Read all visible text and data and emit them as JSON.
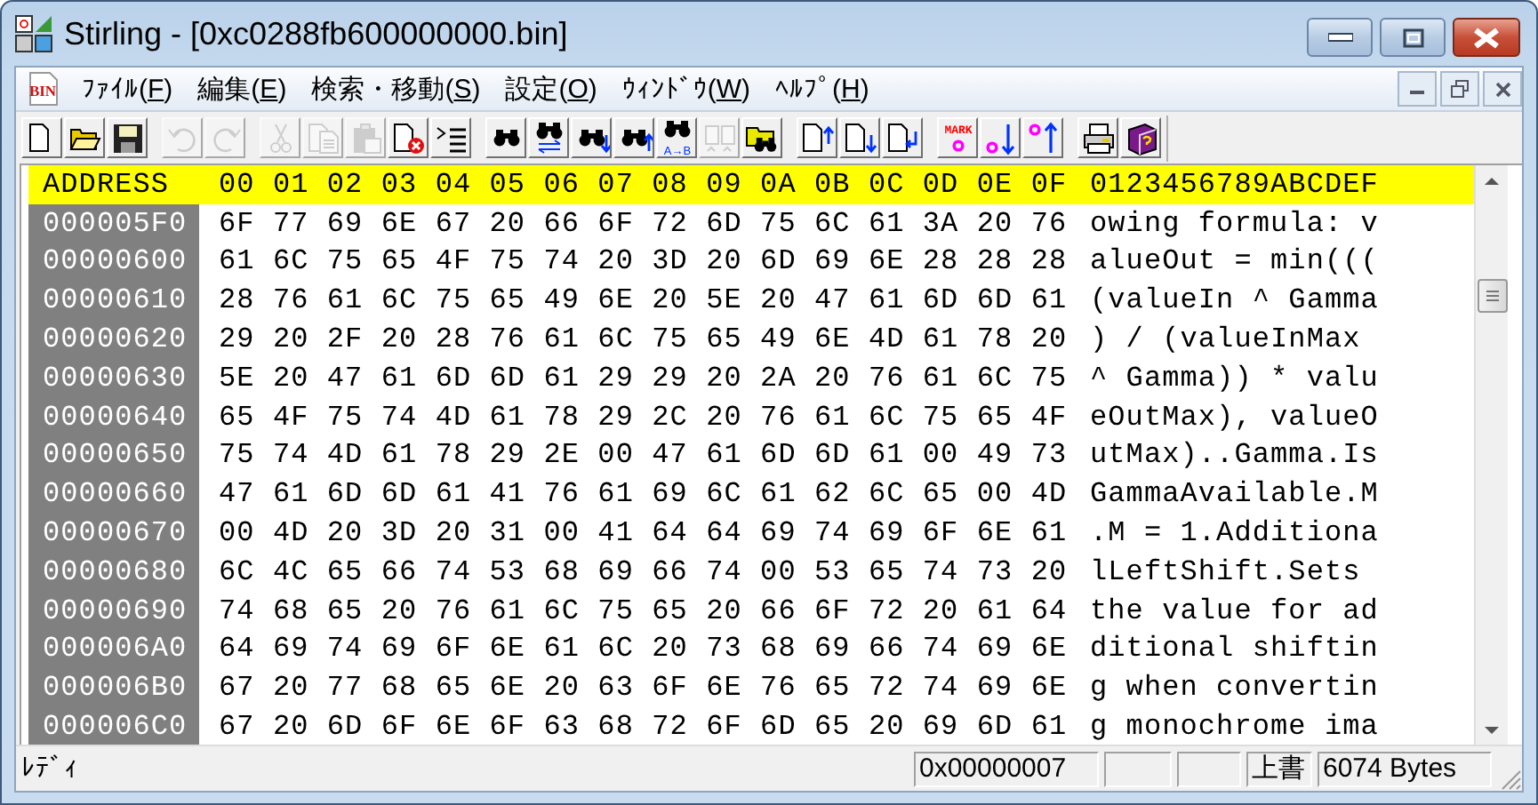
{
  "window": {
    "title": "Stirling - [0xc0288fb600000000.bin]"
  },
  "menu_bar": {
    "icon_label": "BIN",
    "items": [
      {
        "before": "ﾌｧｲﾙ(",
        "key": "F",
        "after": ")"
      },
      {
        "before": "編集(",
        "key": "E",
        "after": ")"
      },
      {
        "before": "検索・移動(",
        "key": "S",
        "after": ")"
      },
      {
        "before": "設定(",
        "key": "O",
        "after": ")"
      },
      {
        "before": "ｳｨﾝﾄﾞｳ(",
        "key": "W",
        "after": ")"
      },
      {
        "before": "ﾍﾙﾌﾟ(",
        "key": "H",
        "after": ")"
      }
    ]
  },
  "toolbar": [
    [
      {
        "kind": "new",
        "disabled": false
      },
      {
        "kind": "open",
        "disabled": false
      },
      {
        "kind": "save",
        "disabled": false
      }
    ],
    [
      {
        "kind": "undo",
        "disabled": true
      },
      {
        "kind": "redo",
        "disabled": true
      }
    ],
    [
      {
        "kind": "cut",
        "disabled": true
      },
      {
        "kind": "copy",
        "disabled": true
      },
      {
        "kind": "paste",
        "disabled": true
      },
      {
        "kind": "close",
        "disabled": false
      },
      {
        "kind": "list",
        "disabled": false
      }
    ],
    [
      {
        "kind": "find",
        "disabled": false
      },
      {
        "kind": "replace",
        "disabled": false
      },
      {
        "kind": "find-next",
        "disabled": false
      },
      {
        "kind": "find-prev",
        "disabled": false
      },
      {
        "kind": "compare",
        "disabled": false,
        "label": "A→B"
      },
      {
        "kind": "compare-pages",
        "disabled": true
      },
      {
        "kind": "find-folder",
        "disabled": false
      }
    ],
    [
      {
        "kind": "doc-up",
        "disabled": false
      },
      {
        "kind": "doc-down",
        "disabled": false
      },
      {
        "kind": "doc-return",
        "disabled": false
      }
    ],
    [
      {
        "kind": "mark",
        "disabled": false,
        "label": "MARK"
      },
      {
        "kind": "mark-next",
        "disabled": false
      },
      {
        "kind": "mark-prev",
        "disabled": false
      }
    ],
    [
      {
        "kind": "print",
        "disabled": false
      },
      {
        "kind": "help",
        "disabled": false
      }
    ]
  ],
  "hex_view": {
    "header": {
      "address": "ADDRESS",
      "offsets": "00 01 02 03 04 05 06 07 08 09 0A 0B 0C 0D 0E 0F",
      "ascii": "0123456789ABCDEF"
    },
    "rows": [
      {
        "address": "000005F0",
        "hex": "6F 77 69 6E 67 20 66 6F 72 6D 75 6C 61 3A 20 76",
        "ascii": "owing formula: v"
      },
      {
        "address": "00000600",
        "hex": "61 6C 75 65 4F 75 74 20 3D 20 6D 69 6E 28 28 28",
        "ascii": "alueOut = min((("
      },
      {
        "address": "00000610",
        "hex": "28 76 61 6C 75 65 49 6E 20 5E 20 47 61 6D 6D 61",
        "ascii": "(valueIn ^ Gamma"
      },
      {
        "address": "00000620",
        "hex": "29 20 2F 20 28 76 61 6C 75 65 49 6E 4D 61 78 20",
        "ascii": ") / (valueInMax "
      },
      {
        "address": "00000630",
        "hex": "5E 20 47 61 6D 6D 61 29 29 20 2A 20 76 61 6C 75",
        "ascii": "^ Gamma)) * valu"
      },
      {
        "address": "00000640",
        "hex": "65 4F 75 74 4D 61 78 29 2C 20 76 61 6C 75 65 4F",
        "ascii": "eOutMax), valueO"
      },
      {
        "address": "00000650",
        "hex": "75 74 4D 61 78 29 2E 00 47 61 6D 6D 61 00 49 73",
        "ascii": "utMax)..Gamma.Is"
      },
      {
        "address": "00000660",
        "hex": "47 61 6D 6D 61 41 76 61 69 6C 61 62 6C 65 00 4D",
        "ascii": "GammaAvailable.M"
      },
      {
        "address": "00000670",
        "hex": "00 4D 20 3D 20 31 00 41 64 64 69 74 69 6F 6E 61",
        "ascii": ".M = 1.Additiona"
      },
      {
        "address": "00000680",
        "hex": "6C 4C 65 66 74 53 68 69 66 74 00 53 65 74 73 20",
        "ascii": "lLeftShift.Sets "
      },
      {
        "address": "00000690",
        "hex": "74 68 65 20 76 61 6C 75 65 20 66 6F 72 20 61 64",
        "ascii": "the value for ad"
      },
      {
        "address": "000006A0",
        "hex": "64 69 74 69 6F 6E 61 6C 20 73 68 69 66 74 69 6E",
        "ascii": "ditional shiftin"
      },
      {
        "address": "000006B0",
        "hex": "67 20 77 68 65 6E 20 63 6F 6E 76 65 72 74 69 6E",
        "ascii": "g when convertin"
      },
      {
        "address": "000006C0",
        "hex": "67 20 6D 6F 6E 6F 63 68 72 6F 6D 65 20 69 6D 61",
        "ascii": "g monochrome ima"
      }
    ]
  },
  "status_bar": {
    "message": "ﾚﾃﾞｨ",
    "position": "0x00000007",
    "mode": "上書",
    "size": "6074 Bytes"
  }
}
